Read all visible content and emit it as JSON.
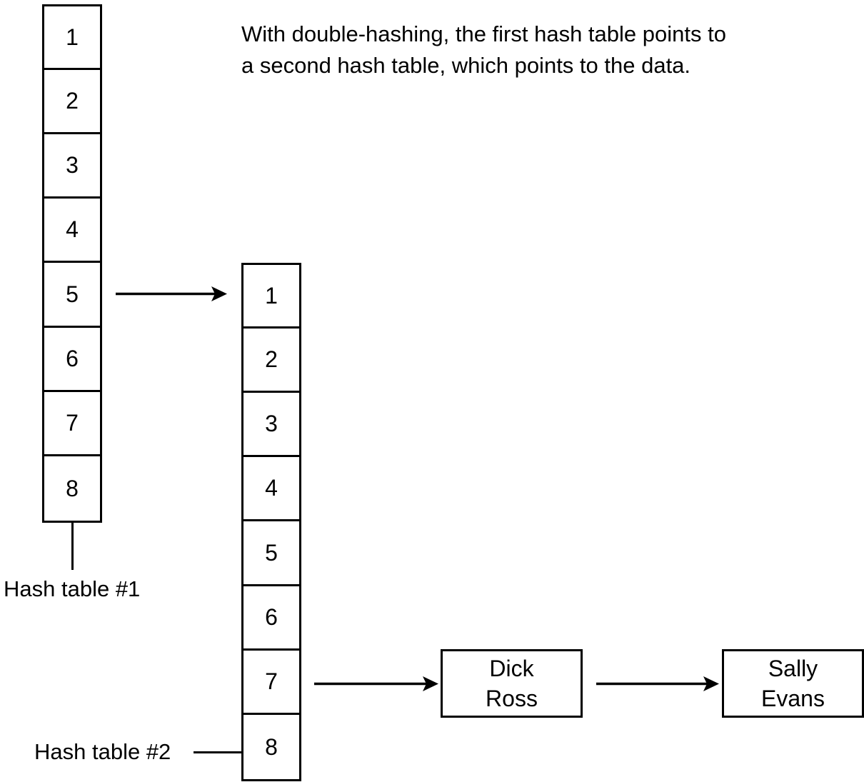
{
  "caption": {
    "text": "With double-hashing, the first hash table points to\na second hash table, which points to the data."
  },
  "colors": {
    "stroke": "#000000",
    "background": "#ffffff",
    "text": "#000000"
  },
  "hash_table_1": {
    "label": "Hash table #1",
    "cells": [
      "1",
      "2",
      "3",
      "4",
      "5",
      "6",
      "7",
      "8"
    ],
    "pointer_from_cell": "5"
  },
  "hash_table_2": {
    "label": "Hash table #2",
    "cells": [
      "1",
      "2",
      "3",
      "4",
      "5",
      "6",
      "7",
      "8"
    ],
    "pointer_from_cell": "7"
  },
  "records": [
    {
      "line1": "Dick",
      "line2": "Ross"
    },
    {
      "line1": "Sally",
      "line2": "Evans"
    }
  ]
}
